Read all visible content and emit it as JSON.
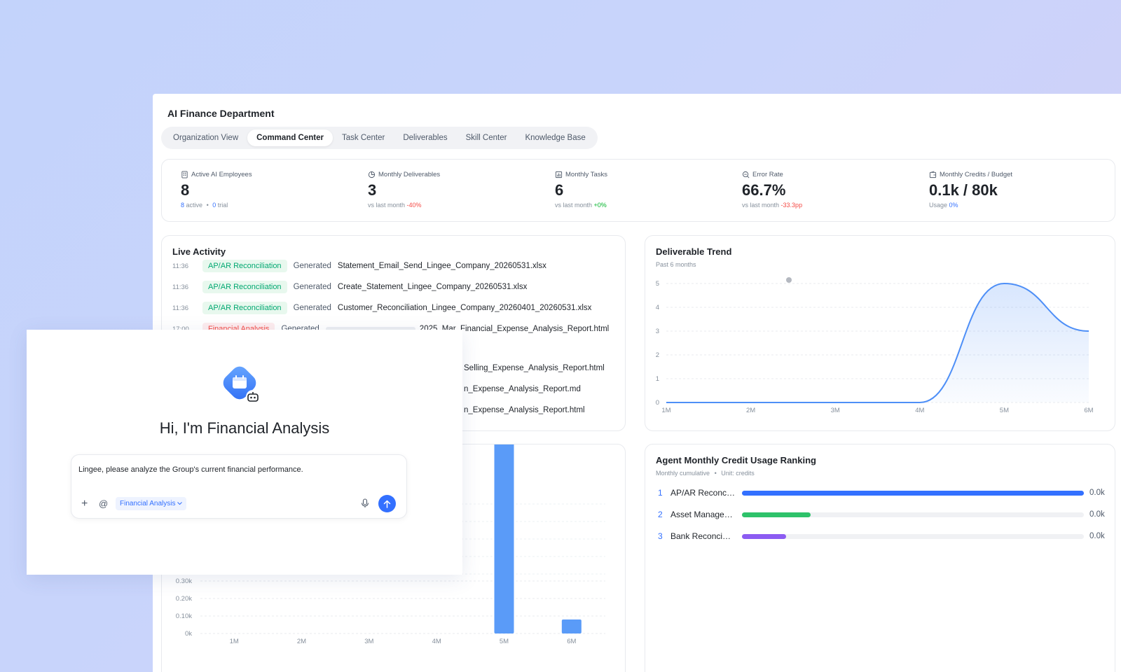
{
  "app": {
    "title": "AI Finance Department"
  },
  "tabs": [
    "Organization View",
    "Command Center",
    "Task Center",
    "Deliverables",
    "Skill Center",
    "Knowledge Base"
  ],
  "stats": {
    "active_employees": {
      "label": "Active AI Employees",
      "value": "8",
      "active_count": "8",
      "active_word": "active",
      "sep": "•",
      "trial_count": "0",
      "trial_word": "trial"
    },
    "deliverables": {
      "label": "Monthly Deliverables",
      "value": "3",
      "sub_prefix": "vs last month",
      "change": "-40%"
    },
    "tasks": {
      "label": "Monthly Tasks",
      "value": "6",
      "sub_prefix": "vs last month",
      "change": "+0%"
    },
    "error_rate": {
      "label": "Error Rate",
      "value": "66.7%",
      "sub_prefix": "vs last month",
      "change": "-33.3pp"
    },
    "credits": {
      "label": "Monthly Credits / Budget",
      "value": "0.1k / 80k",
      "sub_prefix": "Usage",
      "change": "0%"
    }
  },
  "live_activity": {
    "title": "Live Activity",
    "rows": [
      {
        "time": "11:36",
        "tag": "AP/AR Reconciliation",
        "verb": "Generated",
        "file": "Statement_Email_Send_Lingee_Company_20260531.xlsx"
      },
      {
        "time": "11:36",
        "tag": "AP/AR Reconciliation",
        "verb": "Generated",
        "file": "Create_Statement_Lingee_Company_20260531.xlsx"
      },
      {
        "time": "11:36",
        "tag": "AP/AR Reconciliation",
        "verb": "Generated",
        "file": "Customer_Reconciliation_Lingee_Company_20260401_20260531.xlsx"
      },
      {
        "time": "17:00",
        "tag": "Financial Analysis",
        "verb": "Generated",
        "file": "2025_Mar_Financial_Expense_Analysis_Report.html"
      },
      {
        "file": "Selling_Expense_Analysis_Report.html"
      },
      {
        "file": "n_Expense_Analysis_Report.md"
      },
      {
        "file": "n_Expense_Analysis_Report.html"
      }
    ]
  },
  "trend": {
    "title": "Deliverable Trend",
    "subtitle": "Past 6 months"
  },
  "ranking": {
    "title": "Agent Monthly Credit Usage Ranking",
    "subtitle": "Monthly cumulative",
    "sep": "•",
    "unit": "Unit: credits",
    "rows": [
      {
        "rank": "1",
        "name": "AP/AR Reconc…",
        "value": "0.0k",
        "fill": 1.0,
        "color": "#3370ff"
      },
      {
        "rank": "2",
        "name": "Asset Manage…",
        "value": "0.0k",
        "fill": 0.2,
        "color": "#2ec26a"
      },
      {
        "rank": "3",
        "name": "Bank Reconci…",
        "value": "0.0k",
        "fill": 0.13,
        "color": "#8c5cf2"
      }
    ]
  },
  "assistant": {
    "greeting": "Hi, I'm Financial Analysis",
    "input_text": "Lingee, please analyze the Group's current financial performance.",
    "agent_chip": "Financial Analysis",
    "plus": "+",
    "at": "@"
  },
  "chart_data": [
    {
      "type": "area",
      "title": "Deliverable Trend",
      "subtitle": "Past 6 months",
      "x": [
        "1M",
        "2M",
        "3M",
        "4M",
        "5M",
        "6M"
      ],
      "series": [
        {
          "values": [
            0,
            0,
            0,
            0,
            5,
            3
          ]
        }
      ],
      "ylim": [
        0,
        5
      ],
      "yticks": [
        "0",
        "1",
        "2",
        "3",
        "4",
        "5"
      ],
      "grid": true,
      "color": "#4e8ff7"
    },
    {
      "type": "bar",
      "x": [
        "1M",
        "2M",
        "3M",
        "4M",
        "5M",
        "6M"
      ],
      "values": [
        0,
        0,
        0,
        0,
        1.16,
        0.08
      ],
      "yticks": [
        "0k",
        "0.10k",
        "0.20k",
        "0.30k"
      ],
      "grid": true,
      "color": "#5a9bf8"
    }
  ]
}
